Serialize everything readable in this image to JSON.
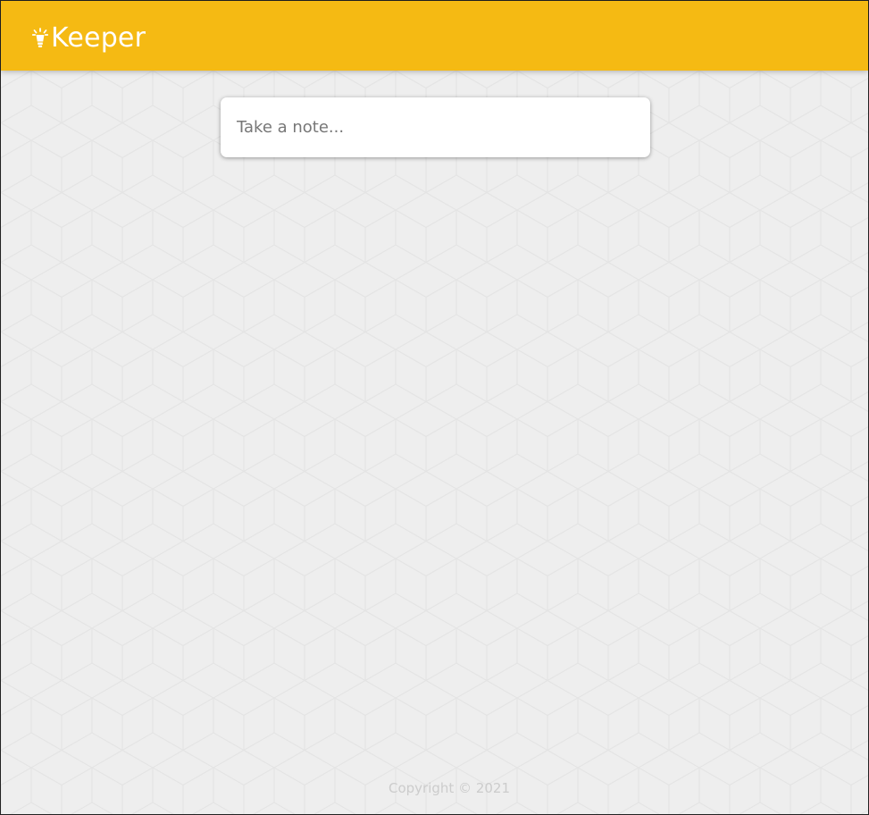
{
  "header": {
    "title": "Keeper",
    "icon": "lightbulb-icon",
    "background_color": "#f5ba13",
    "text_color": "#ffffff"
  },
  "note_form": {
    "placeholder": "Take a note...",
    "value": ""
  },
  "footer": {
    "copyright": "Copyright © 2021",
    "text_color": "#cccccc"
  },
  "page": {
    "background_color": "#eeeeee",
    "background_pattern": "hexagon-cube"
  }
}
